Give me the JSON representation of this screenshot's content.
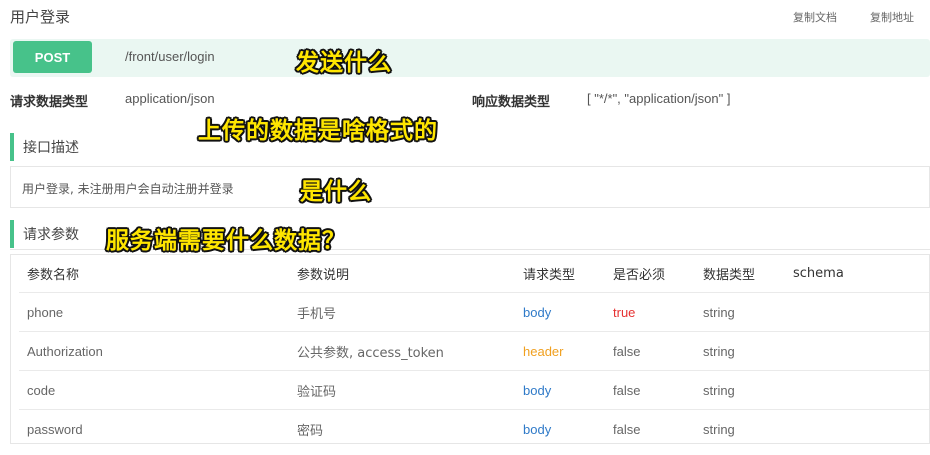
{
  "header": {
    "title": "用户登录",
    "copy_doc": "复制文档",
    "copy_address": "复制地址"
  },
  "endpoint": {
    "method": "POST",
    "path": "/front/user/login"
  },
  "meta": {
    "request_type_label": "请求数据类型",
    "request_type_value": "application/json",
    "response_type_label": "响应数据类型",
    "response_type_value": "[ \"*/*\", \"application/json\" ]"
  },
  "sections": {
    "description_title": "接口描述",
    "description_text": "用户登录, 未注册用户会自动注册并登录",
    "params_title": "请求参数"
  },
  "params_table": {
    "headers": [
      "参数名称",
      "参数说明",
      "请求类型",
      "是否必须",
      "数据类型",
      "schema"
    ],
    "rows": [
      {
        "name": "phone",
        "desc": "手机号",
        "in": "body",
        "required": "true",
        "type": "string"
      },
      {
        "name": "Authorization",
        "desc": "公共参数, access_token",
        "in": "header",
        "required": "false",
        "type": "string"
      },
      {
        "name": "code",
        "desc": "验证码",
        "in": "body",
        "required": "false",
        "type": "string"
      },
      {
        "name": "password",
        "desc": "密码",
        "in": "body",
        "required": "false",
        "type": "string"
      }
    ]
  },
  "annotations": {
    "send_what": "发送什么",
    "upload_format": "上传的数据是啥格式的",
    "what_is_it": "是什么",
    "server_needs": "服务端需要什么数据？"
  },
  "colors": {
    "accent_green": "#47c28a",
    "body_blue": "#2f7ac8",
    "header_orange": "#f0a020",
    "required_red": "#e63232",
    "annotation_yellow": "#ffe600"
  }
}
